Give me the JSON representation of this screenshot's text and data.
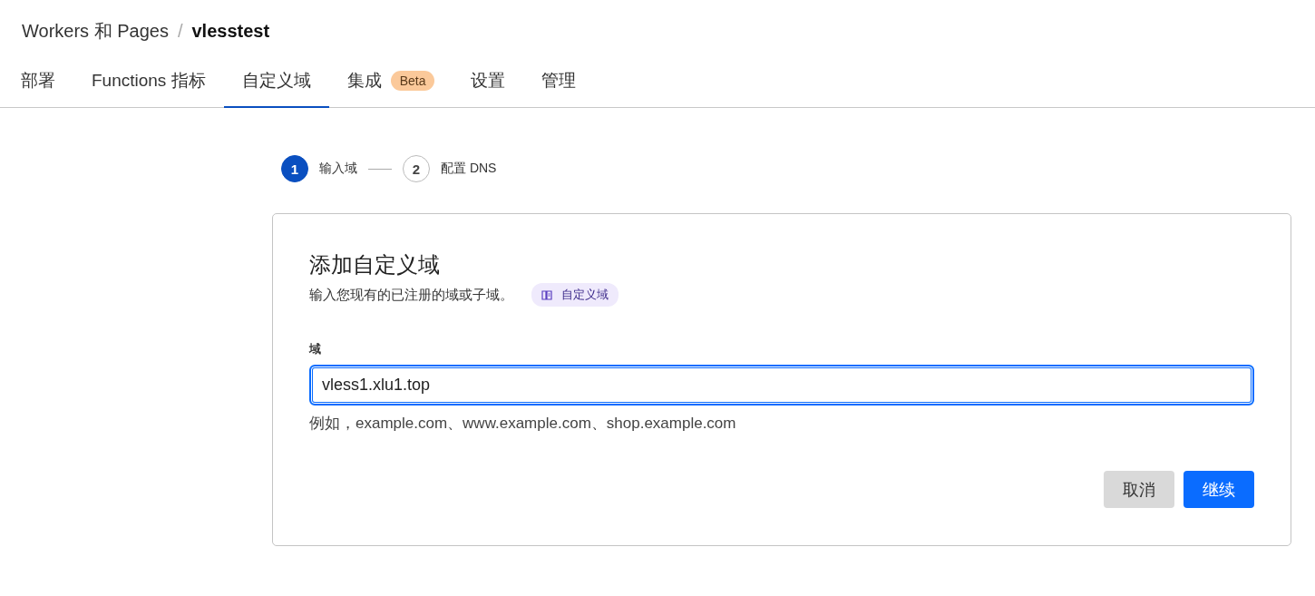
{
  "breadcrumb": {
    "parent": "Workers 和 Pages",
    "separator": "/",
    "current": "vlesstest"
  },
  "tabs": [
    {
      "label": "部署",
      "selected": false
    },
    {
      "label": "Functions 指标",
      "selected": false
    },
    {
      "label": "自定义域",
      "selected": true
    },
    {
      "label": "集成",
      "badge": "Beta",
      "selected": false
    },
    {
      "label": "设置",
      "selected": false
    },
    {
      "label": "管理",
      "selected": false
    }
  ],
  "steps": [
    {
      "number": "1",
      "label": "输入域",
      "selected": true
    },
    {
      "number": "2",
      "label": "配置 DNS",
      "selected": false
    }
  ],
  "card": {
    "title": "添加自定义域",
    "subtitle": "输入您现有的已注册的域或子域。",
    "doc_link": "自定义域",
    "field": {
      "label": "域",
      "value": "vless1.xlu1.top",
      "hint": "例如，example.com、www.example.com、shop.example.com"
    },
    "buttons": [
      {
        "label": "取消",
        "kind": "secondary"
      },
      {
        "label": "继续",
        "kind": "primary"
      }
    ]
  }
}
